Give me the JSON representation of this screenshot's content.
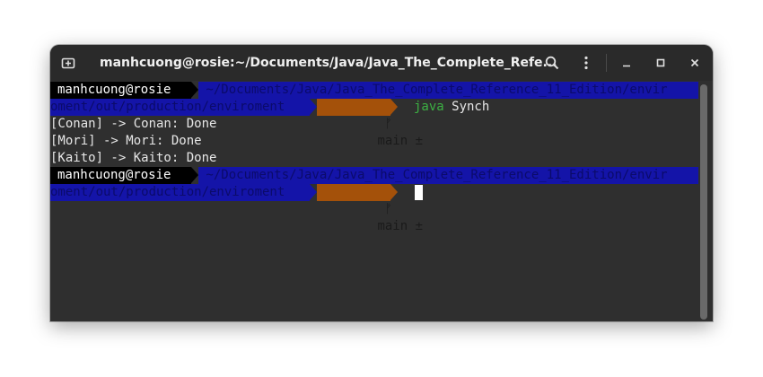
{
  "window": {
    "title": "manhcuong@rosie:~/Documents/Java/Java_The_Complete_Refe..."
  },
  "titlebar": {
    "new_tab_icon": "new-tab-icon",
    "search_icon": "search-icon",
    "menu_icon": "kebab-menu-icon",
    "minimize_icon": "minimize-icon",
    "maximize_icon": "maximize-icon",
    "close_icon": "close-icon"
  },
  "prompt1": {
    "user": "manhcuong@rosie",
    "path_line1": " ~/Documents/Java/Java_The_Complete_Reference_11_Edition/envir",
    "path_line2": "oment/out/production/enviroment ",
    "branch": "main ±",
    "cmd_program": "java",
    "cmd_args": " Synch"
  },
  "output": [
    "[Conan] -> Conan: Done",
    "[Mori] -> Mori: Done",
    "[Kaito] -> Kaito: Done"
  ],
  "prompt2": {
    "user": "manhcuong@rosie",
    "path_line1": " ~/Documents/Java/Java_The_Complete_Reference_11_Edition/envir",
    "path_line2": "oment/out/production/enviroment ",
    "branch": "main ±"
  },
  "colors": {
    "path_bg": "#1414a8",
    "git_bg": "#a4510a",
    "java_cmd": "#3cb043",
    "terminal_bg": "#2f2f2f"
  }
}
